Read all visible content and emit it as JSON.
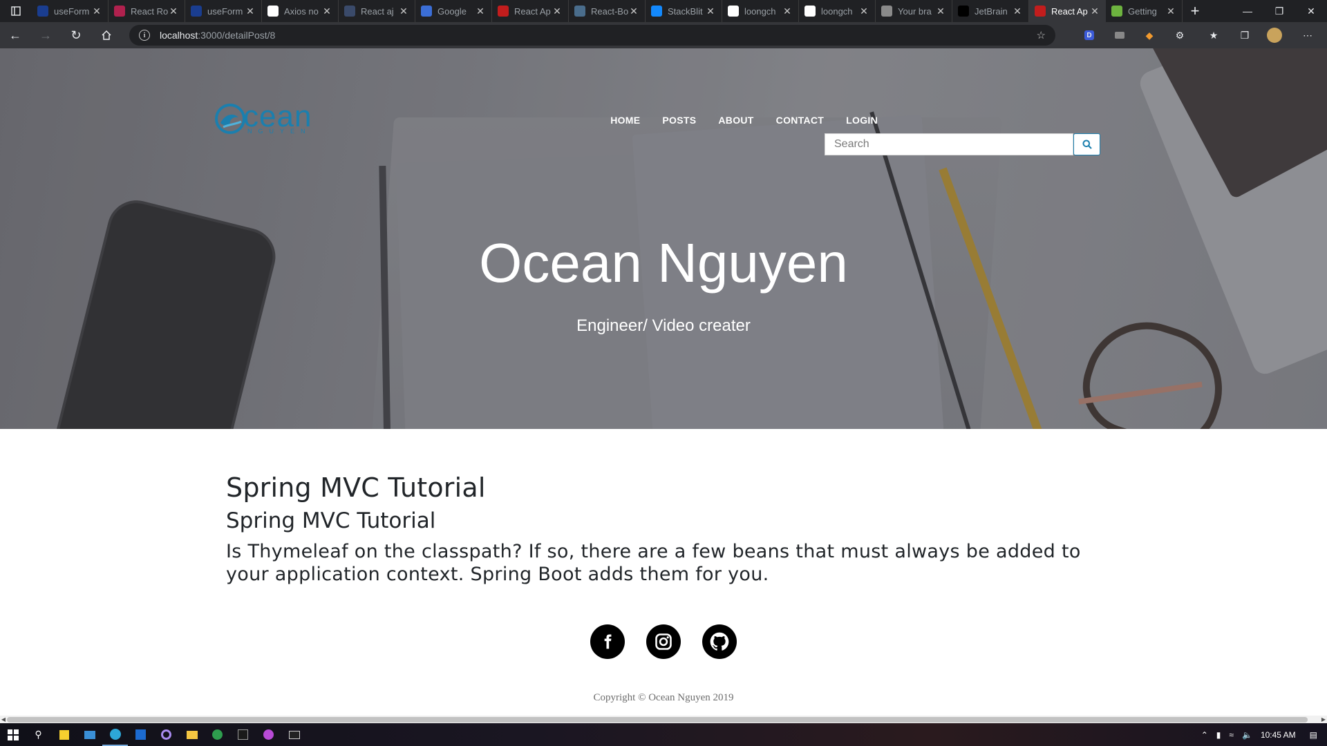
{
  "browser": {
    "tabs": [
      {
        "title": "useForm",
        "favicon_color": "#1a3d8f"
      },
      {
        "title": "React Ro",
        "favicon_color": "#b0214e"
      },
      {
        "title": "useForm",
        "favicon_color": "#1a3d8f"
      },
      {
        "title": "Axios no",
        "favicon_color": "#ffffff"
      },
      {
        "title": "React aj",
        "favicon_color": "#3a4a6a"
      },
      {
        "title": "Google",
        "favicon_color": "#3b6ed6"
      },
      {
        "title": "React Ap",
        "favicon_color": "#c21d1d"
      },
      {
        "title": "React-Bo",
        "favicon_color": "#4a6d8c"
      },
      {
        "title": "StackBlit",
        "favicon_color": "#1389fd"
      },
      {
        "title": "loongch",
        "favicon_color": "#ffffff"
      },
      {
        "title": "loongch",
        "favicon_color": "#ffffff"
      },
      {
        "title": "Your bra",
        "favicon_color": "#8a8a8a"
      },
      {
        "title": "JetBrain",
        "favicon_color": "#000000"
      },
      {
        "title": "React Ap",
        "favicon_color": "#c21d1d"
      },
      {
        "title": "Getting",
        "favicon_color": "#6db33f"
      }
    ],
    "url_host": "localhost",
    "url_path": ":3000/detailPost/8"
  },
  "site": {
    "logo_text": "cean",
    "logo_sub": "NGUYEN",
    "nav": [
      "HOME",
      "POSTS",
      "ABOUT",
      "CONTACT",
      "LOGIN"
    ],
    "search_placeholder": "Search",
    "hero_title": "Ocean Nguyen",
    "hero_subtitle": "Engineer/ Video creater",
    "accent": "#1b7fae"
  },
  "post": {
    "title": "Spring MVC Tutorial",
    "subtitle": "Spring MVC Tutorial",
    "body": "Is Thymeleaf on the classpath? If so, there are a few beans that must always be added to your application context. Spring Boot adds them for you."
  },
  "footer": {
    "social": [
      "facebook-icon",
      "instagram-icon",
      "github-icon"
    ],
    "copyright": "Copyright © Ocean Nguyen 2019"
  },
  "taskbar": {
    "time": "10:45 AM"
  }
}
